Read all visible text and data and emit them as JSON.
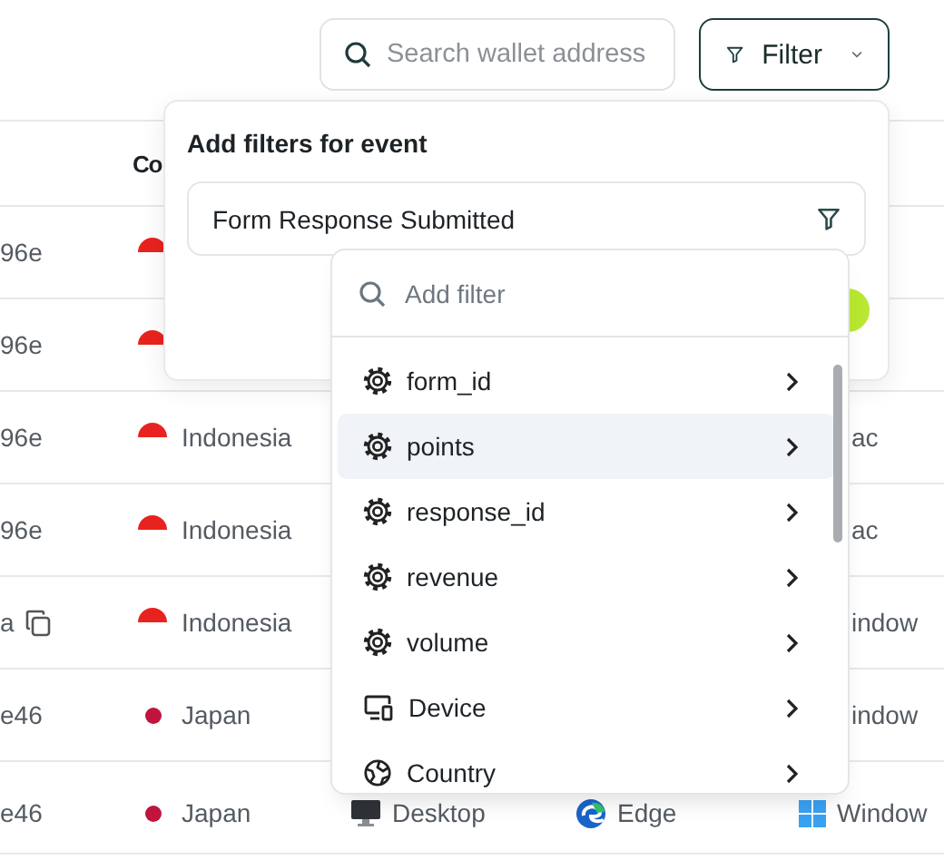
{
  "toolbar": {
    "search": {
      "placeholder": "Search wallet address"
    },
    "filter_button": {
      "label": "Filter"
    }
  },
  "table": {
    "column_2_header": "Co",
    "rows": [
      {
        "address": "96e",
        "flag": {
          "kind": "bicolor",
          "color": "#e8231f"
        }
      },
      {
        "address": "96e",
        "flag": {
          "kind": "bicolor",
          "color": "#e8231f"
        }
      },
      {
        "address": "96e",
        "flag": {
          "kind": "bicolor",
          "color": "#e8231f"
        },
        "country": "Indonesia",
        "os": {
          "label": "ac"
        }
      },
      {
        "address": "96e",
        "flag": {
          "kind": "bicolor",
          "color": "#e8231f"
        },
        "country": "Indonesia",
        "os": {
          "label": "ac"
        }
      },
      {
        "address": "a",
        "copy_icon": true,
        "flag": {
          "kind": "bicolor",
          "color": "#e8231f"
        },
        "country": "Indonesia",
        "os": {
          "label": "indow"
        }
      },
      {
        "address": "e46",
        "flag": {
          "kind": "dot",
          "color": "#c0143c"
        },
        "country": "Japan",
        "os": {
          "label": "indow"
        }
      },
      {
        "address": "e46",
        "flag": {
          "kind": "dot",
          "color": "#c0143c"
        },
        "country": "Japan",
        "device": {
          "label": "Desktop",
          "icon_shown": true
        },
        "browser": {
          "label": "Edge",
          "icon_shown": true
        },
        "os": {
          "label": "Window",
          "icon_shown": true
        }
      }
    ]
  },
  "filter_panel": {
    "title": "Add filters for event",
    "event_select": {
      "value": "Form Response Submitted"
    }
  },
  "filter_dropdown": {
    "search": {
      "placeholder": "Add filter"
    },
    "items": [
      {
        "label": "form_id",
        "kind": "property",
        "selected": false
      },
      {
        "label": "points",
        "kind": "property",
        "selected": true
      },
      {
        "label": "response_id",
        "kind": "property",
        "selected": false
      },
      {
        "label": "revenue",
        "kind": "property",
        "selected": false
      },
      {
        "label": "volume",
        "kind": "property",
        "selected": false
      },
      {
        "label": "Device",
        "kind": "device",
        "selected": false
      },
      {
        "label": "Country",
        "kind": "location",
        "selected": false
      }
    ]
  }
}
